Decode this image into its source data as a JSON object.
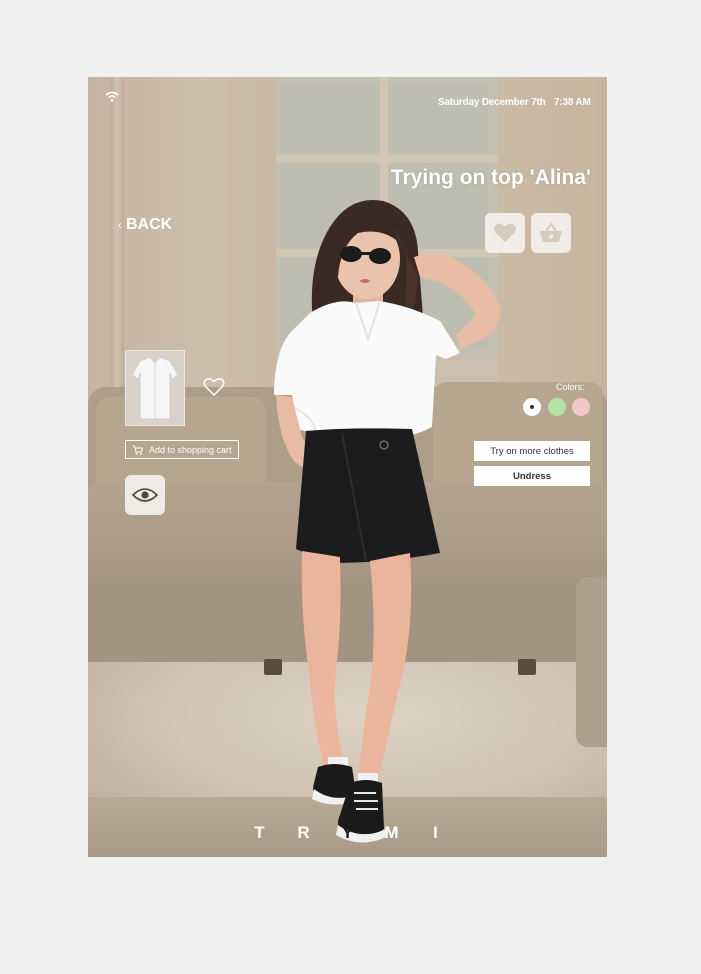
{
  "status_bar": {
    "icon": "wifi-icon",
    "date": "Saturday December 7th",
    "time": "7:38 AM"
  },
  "header": {
    "title": "Trying on top 'Alina'",
    "back_label": "BACK",
    "back_icon": "chevron-left-icon"
  },
  "actions": {
    "favorite_icon": "heart-icon",
    "basket_icon": "basket-icon",
    "eye_icon": "eye-icon"
  },
  "product": {
    "thumbnail_icon": "shirt-thumbnail",
    "wishlist_icon": "heart-outline-icon",
    "add_to_cart_label": "Add to shopping cart",
    "cart_icon": "cart-icon"
  },
  "colors": {
    "label": "Colors:",
    "options": [
      "#ffffff",
      "#b4e3a5",
      "#f5c6c7"
    ],
    "selected_index": 0
  },
  "buttons": {
    "try_more": "Try on more clothes",
    "undress": "Undress"
  },
  "brand": {
    "letters": [
      "T",
      "R",
      "Y",
      "M",
      "I"
    ]
  }
}
